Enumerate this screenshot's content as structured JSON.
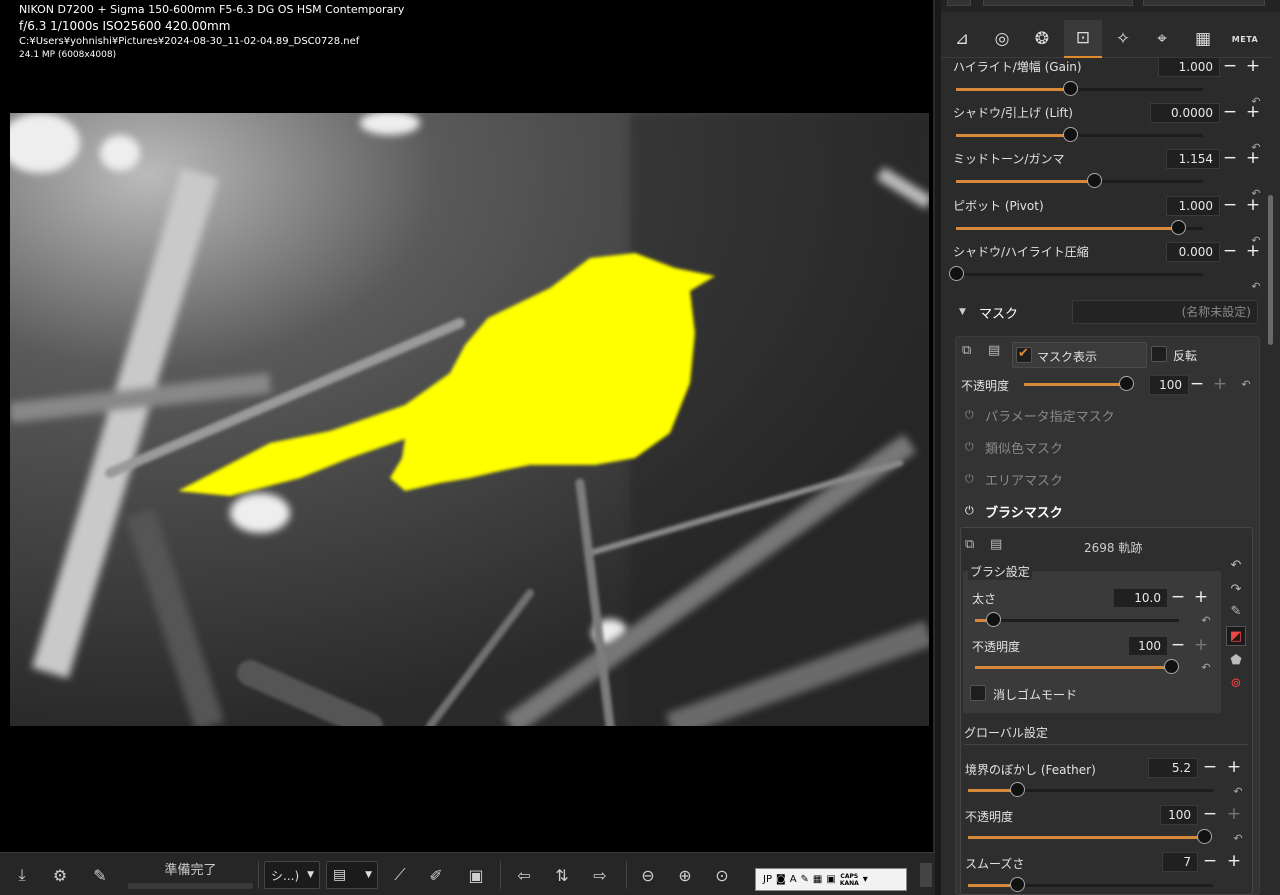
{
  "exif": {
    "camera": "NIKON D7200 + Sigma 150-600mm F5-6.3 DG OS HSM Contemporary",
    "exposure": "f/6.3  1/1000s  ISO25600  420.00mm",
    "path": "C:¥Users¥yohnishi¥Pictures¥2024-08-30_11-02-04.89_DSC0728.nef",
    "resolution": "24.1 MP (6008x4008)"
  },
  "toolbar": {
    "status": "準備完了",
    "mode_dropdown": "シ...)"
  },
  "tabs": [
    "exposure-icon",
    "tone-icon",
    "color-icon",
    "mask-icon",
    "retouch-icon",
    "geometry-icon",
    "noise-icon",
    "META"
  ],
  "tone": {
    "rows": [
      {
        "label": "ハイライト/増幅 (Gain)",
        "value": "1.000",
        "level": 0.46
      },
      {
        "label": "シャドウ/引上げ (Lift)",
        "value": "0.0000",
        "level": 0.46
      },
      {
        "label": "ミッドトーン/ガンマ",
        "value": "1.154",
        "level": 0.56
      },
      {
        "label": "ピボット (Pivot)",
        "value": "1.000",
        "level": 0.9
      },
      {
        "label": "シャドウ/ハイライト圧縮",
        "value": "0.000",
        "level": 0.0
      }
    ]
  },
  "mask": {
    "title": "マスク",
    "name_placeholder": "(名称未設定)",
    "show_label": "マスク表示",
    "invert_label": "反転",
    "opacity_label": "不透明度",
    "opacity_value": "100",
    "opacity_level": 1.0,
    "param_mask": "パラメータ指定マスク",
    "similar_color_mask": "類似色マスク",
    "area_mask": "エリアマスク",
    "brush_mask": "ブラシマスク",
    "stroke_count": "2698 軌跡"
  },
  "brush": {
    "settings_title": "ブラシ設定",
    "size_label": "太さ",
    "size_value": "10.0",
    "size_level": 0.09,
    "opacity_label": "不透明度",
    "opacity_value": "100",
    "opacity_level": 1.0,
    "eraser_label": "消しゴムモード"
  },
  "global": {
    "title": "グローバル設定",
    "feather_label": "境界のぼかし (Feather)",
    "feather_value": "5.2",
    "feather_level": 0.2,
    "opacity_label": "不透明度",
    "opacity_value": "100",
    "opacity_level": 1.0,
    "smooth_label": "スムーズさ",
    "smooth_value": "7",
    "smooth_level": 0.2
  },
  "ime": {
    "jp": "JP",
    "caps": "CAPS",
    "kana": "KANA"
  },
  "colors": {
    "accent": "#e08a2c",
    "mask_overlay": "#ffff00",
    "panel_bg": "#2b2b2b"
  }
}
